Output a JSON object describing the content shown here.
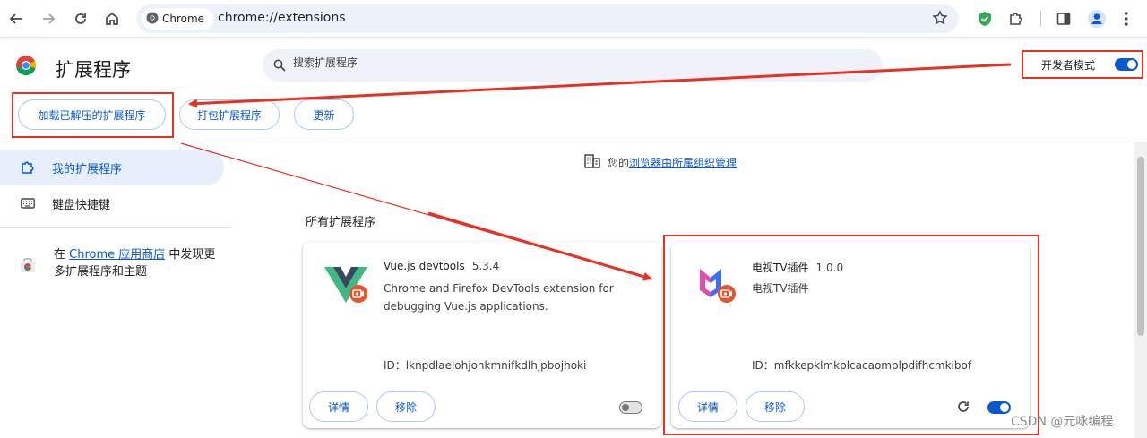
{
  "browser": {
    "chip_label": "Chrome",
    "url": "chrome://extensions"
  },
  "header": {
    "title": "扩展程序",
    "search_placeholder": "搜索扩展程序",
    "dev_mode_label": "开发者模式",
    "dev_mode_on": true
  },
  "actions": {
    "load_unpacked": "加载已解压的扩展程序",
    "pack": "打包扩展程序",
    "update": "更新"
  },
  "sidebar": {
    "items": [
      {
        "label": "我的扩展程序",
        "active": true
      },
      {
        "label": "键盘快捷键",
        "active": false
      }
    ],
    "webstore_prefix": "在 ",
    "webstore_link": "Chrome 应用商店",
    "webstore_suffix": " 中发现更多扩展程序和主题"
  },
  "main": {
    "managed_prefix": "您的",
    "managed_link": "浏览器由所属组织管理",
    "section_title": "所有扩展程序",
    "extensions": [
      {
        "name": "Vue.js devtools",
        "version": "5.3.4",
        "description": "Chrome and Firefox DevTools extension for debugging Vue.js applications.",
        "id_line": "ID：lknpdlaelohjonkmnifkdlhjpbojhoki",
        "details_label": "详情",
        "remove_label": "移除",
        "enabled": false
      },
      {
        "name": "电视TV插件",
        "version": "1.0.0",
        "description": "电视TV插件",
        "id_line": "ID：mfkkepklmkplcacaomplpdifhcmkibof",
        "details_label": "详情",
        "remove_label": "移除",
        "enabled": true
      }
    ]
  },
  "watermark": "CSDN @元咏编程",
  "colors": {
    "accent": "#0b57d0",
    "annotation_red": "#e53224"
  }
}
